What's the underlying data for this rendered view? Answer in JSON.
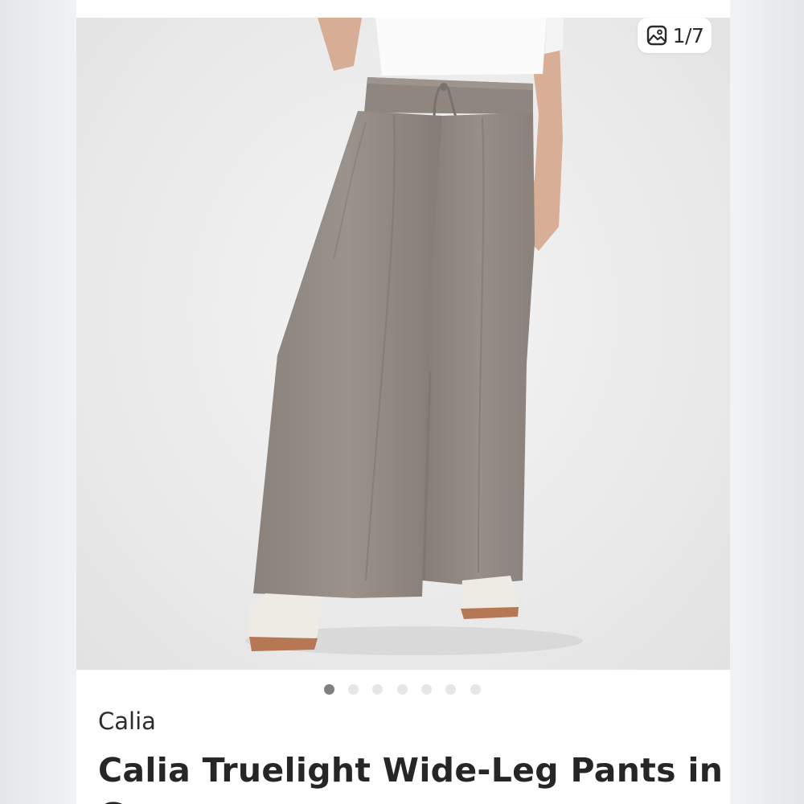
{
  "gallery": {
    "counter_text": "1/7",
    "counter_icon": "image-gallery-icon",
    "image_alt": "Model wearing taupe wide-leg drawstring pants with white sneakers",
    "dots_total": 7,
    "active_dot": 1
  },
  "product": {
    "brand": "Calia",
    "title": "Calia Truelight Wide-Leg Pants in G"
  },
  "colors": {
    "pants": "#938a83",
    "background": "#ebebeb",
    "accent_dot": "#808080"
  }
}
